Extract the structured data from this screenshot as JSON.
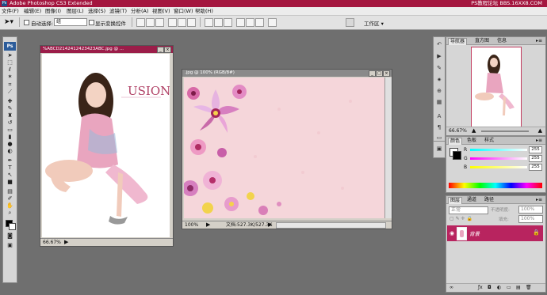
{
  "app": {
    "title": "Adobe Photoshop CS3 Extended",
    "logo": "Ps",
    "watermark": "PS教程论坛 BBS.16XX8.COM"
  },
  "menu": [
    "文件(F)",
    "编辑(E)",
    "图像(I)",
    "图层(L)",
    "选择(S)",
    "滤镜(T)",
    "分析(A)",
    "视图(V)",
    "窗口(W)",
    "帮助(H)"
  ],
  "options": {
    "auto_select_label": "自动选择:",
    "auto_select_value": "组",
    "show_transform_label": "显示变换控件",
    "workspace_label": "工作区 ▾"
  },
  "doc1": {
    "title": "%ABCD2142412423423ABC.jpg @ ...",
    "brand_text": "USION",
    "zoom": "66.67%"
  },
  "doc2": {
    "title": ".jpg @ 100% (RGB/8#)",
    "zoom": "100%",
    "doc_info": "文档:527.3K/527.3K"
  },
  "navigator": {
    "tabs": [
      "导航器",
      "直方图",
      "信息"
    ],
    "zoom": "66.67%"
  },
  "color_panel": {
    "tabs": [
      "颜色",
      "色板",
      "样式"
    ],
    "r_label": "R",
    "g_label": "G",
    "b_label": "B",
    "r_value": "255",
    "g_value": "255",
    "b_value": "255"
  },
  "layers_panel": {
    "tabs": [
      "图层",
      "通道",
      "路径"
    ],
    "blend_mode": "正常",
    "opacity_label": "不透明度:",
    "opacity_value": "100%",
    "fill_label": "填充:",
    "fill_value": "100%",
    "layer_name": "背景"
  },
  "colors": {
    "accent": "#a4163f",
    "layer_selected": "#b8245f",
    "doc_title_active": "#9b1d49",
    "doc_title_inactive": "#8a8a8a"
  }
}
